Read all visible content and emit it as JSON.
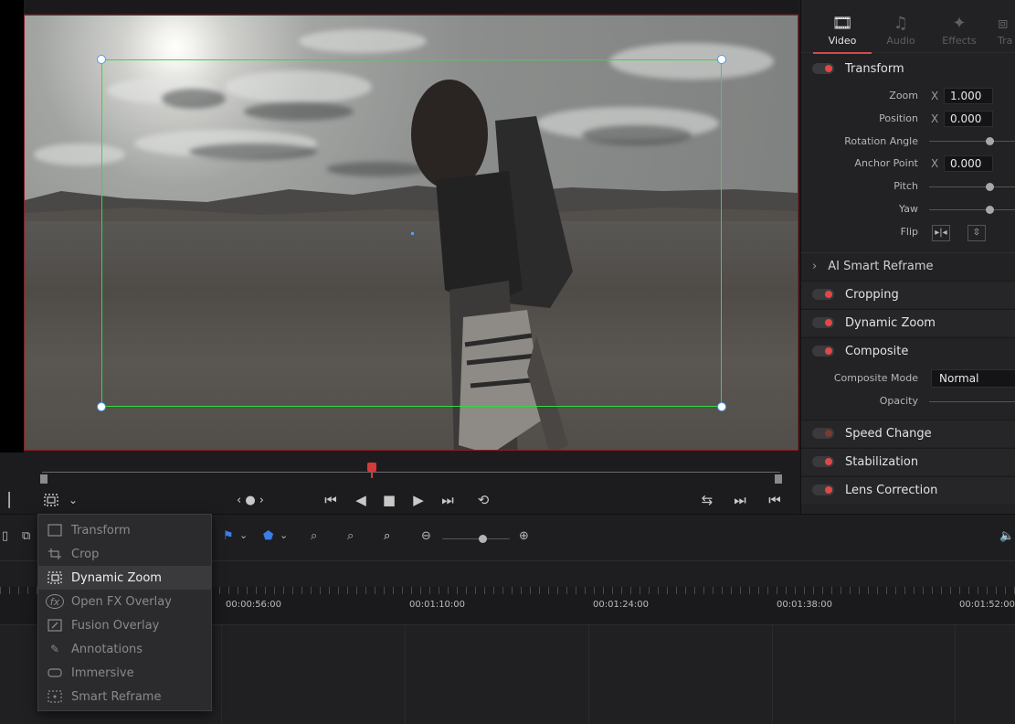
{
  "inspector": {
    "tabs": [
      {
        "label": "Video",
        "icon": "film-icon"
      },
      {
        "label": "Audio",
        "icon": "music-note-icon"
      },
      {
        "label": "Effects",
        "icon": "magic-wand-icon"
      },
      {
        "label": "Tra",
        "icon": "transition-icon"
      }
    ],
    "transform": {
      "title": "Transform",
      "zoom_label": "Zoom",
      "zoom_x": "X",
      "zoom_value": "1.000",
      "position_label": "Position",
      "position_x": "X",
      "position_value": "0.000",
      "rotation_label": "Rotation Angle",
      "anchor_label": "Anchor Point",
      "anchor_x": "X",
      "anchor_value": "0.000",
      "pitch_label": "Pitch",
      "yaw_label": "Yaw",
      "flip_label": "Flip"
    },
    "ai_reframe": "AI Smart Reframe",
    "cropping": "Cropping",
    "dynamic_zoom": "Dynamic Zoom",
    "composite": {
      "title": "Composite",
      "mode_label": "Composite Mode",
      "mode_value": "Normal",
      "opacity_label": "Opacity"
    },
    "speed_change": "Speed Change",
    "stabilization": "Stabilization",
    "lens_correction": "Lens Correction"
  },
  "timeline": {
    "timecodes": [
      "00:00:56:00",
      "00:01:10:00",
      "00:01:24:00",
      "00:01:38:00",
      "00:01:52:00"
    ]
  },
  "menu": {
    "items": [
      {
        "label": "Transform",
        "icon": "transform-icon",
        "selected": false
      },
      {
        "label": "Crop",
        "icon": "crop-icon",
        "selected": false
      },
      {
        "label": "Dynamic Zoom",
        "icon": "dynamic-zoom-icon",
        "selected": true
      },
      {
        "label": "Open FX Overlay",
        "icon": "fx-icon",
        "selected": false
      },
      {
        "label": "Fusion Overlay",
        "icon": "fusion-icon",
        "selected": false
      },
      {
        "label": "Annotations",
        "icon": "pen-icon",
        "selected": false
      },
      {
        "label": "Immersive",
        "icon": "vr-headset-icon",
        "selected": false
      },
      {
        "label": "Smart Reframe",
        "icon": "smart-reframe-icon",
        "selected": false
      }
    ]
  },
  "colors": {
    "accent_red": "#d44a4a",
    "frame_green": "#35d845",
    "handle_blue": "#4a9cf0"
  }
}
